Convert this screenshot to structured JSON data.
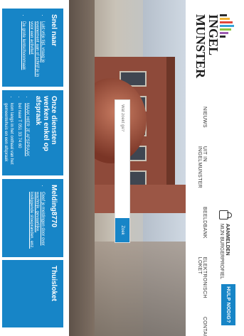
{
  "header": {
    "logo": {
      "line1": "INGEL",
      "line2": "MUNSTER"
    },
    "nav": [
      {
        "label": "NIEUWS"
      },
      {
        "label": "UIT IN INGELMUNSTER"
      },
      {
        "label": "BEELDBANK"
      },
      {
        "label": "ELEKTRONISCH LOKET"
      },
      {
        "label": "CONTACT"
      }
    ],
    "login": {
      "title": "AANMELDEN",
      "subtitle": "MIJN BURGERPROFIEL"
    },
    "help_label": "HULP NODIG?"
  },
  "hero": {
    "search": {
      "placeholder": "Wat zoekt ge?",
      "button": "Zoek"
    }
  },
  "tiles": [
    {
      "title": "Snel naar",
      "items": [
        "Lukt vrije tijd, vraag je evenement aan of schrijf je in voor een activiteit",
        "De grote lentschoonmaak"
      ]
    },
    {
      "title": "Onze diensten werken enkel op afspraak",
      "items": [
        "MAAK HIER JE AFSPRAAK",
        "bel naar T 051 33 74 60",
        "kom langs in het onthaal van het gemeentehuis en een afspraak vast te leggen"
      ]
    },
    {
      "title": "Melding8770",
      "items": [
        "Geef je meldingen door over wachtrijk, gevaarlijke, losliggende stoepranden, enz."
      ]
    },
    {
      "title": "Thuisloket",
      "items": []
    }
  ]
}
